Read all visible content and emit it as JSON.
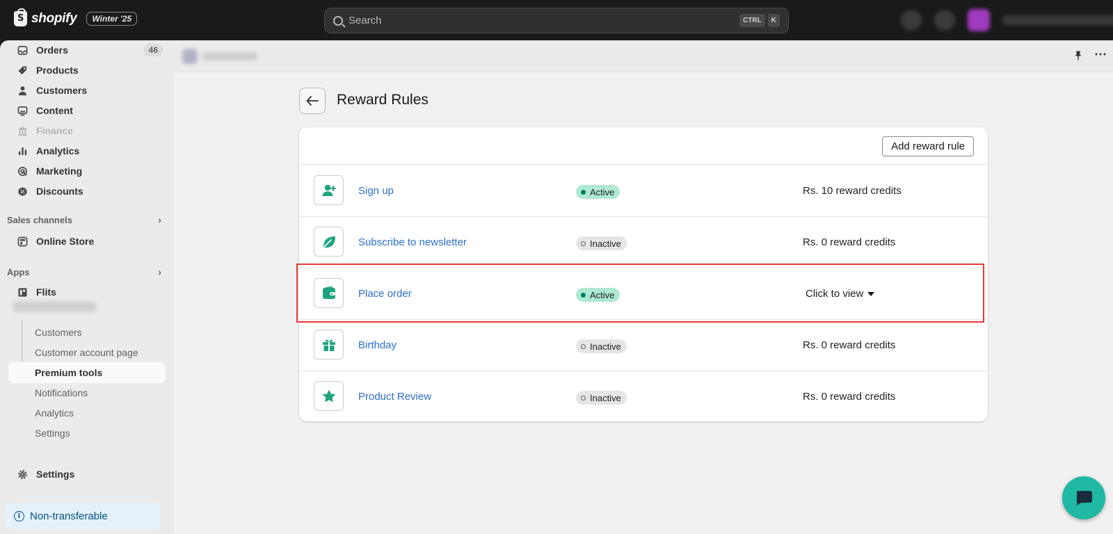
{
  "topbar": {
    "brand": "shopify",
    "edition": "Winter '25",
    "search_placeholder": "Search",
    "shortcut_key1": "CTRL",
    "shortcut_key2": "K"
  },
  "sidebar": {
    "items": [
      {
        "label": "Orders",
        "count": "46",
        "icon": "orders-icon"
      },
      {
        "label": "Products",
        "icon": "tag-icon"
      },
      {
        "label": "Customers",
        "icon": "person-icon"
      },
      {
        "label": "Content",
        "icon": "image-icon"
      },
      {
        "label": "Finance",
        "icon": "bank-icon",
        "disabled": true
      },
      {
        "label": "Analytics",
        "icon": "bar-chart-icon"
      },
      {
        "label": "Marketing",
        "icon": "target-icon"
      },
      {
        "label": "Discounts",
        "icon": "discount-icon"
      }
    ],
    "sales_channels_header": "Sales channels",
    "online_store": "Online Store",
    "apps_header": "Apps",
    "app_flits": "Flits",
    "sub_items": [
      "Customers",
      "Customer account page",
      "Premium tools",
      "Notifications",
      "Analytics",
      "Settings"
    ],
    "active_sub_item": "Premium tools",
    "settings": "Settings",
    "notice": "Non-transferable"
  },
  "page": {
    "title": "Reward Rules",
    "add_button": "Add reward rule"
  },
  "rules": [
    {
      "name": "Sign up",
      "status": "Active",
      "reward": "Rs. 10 reward credits",
      "icon": "user-add-icon"
    },
    {
      "name": "Subscribe to newsletter",
      "status": "Inactive",
      "reward": "Rs. 0 reward credits",
      "icon": "leaf-icon"
    },
    {
      "name": "Place order",
      "status": "Active",
      "reward": "Click to view",
      "icon": "wallet-icon"
    },
    {
      "name": "Birthday",
      "status": "Inactive",
      "reward": "Rs. 0 reward credits",
      "icon": "gift-icon"
    },
    {
      "name": "Product Review",
      "status": "Inactive",
      "reward": "Rs. 0 reward credits",
      "icon": "star-icon"
    }
  ],
  "colors": {
    "accent_green": "#1fa37f",
    "link_blue": "#2c6ecb",
    "highlight_red": "#e53935",
    "chat_teal": "#1fb8a3"
  }
}
